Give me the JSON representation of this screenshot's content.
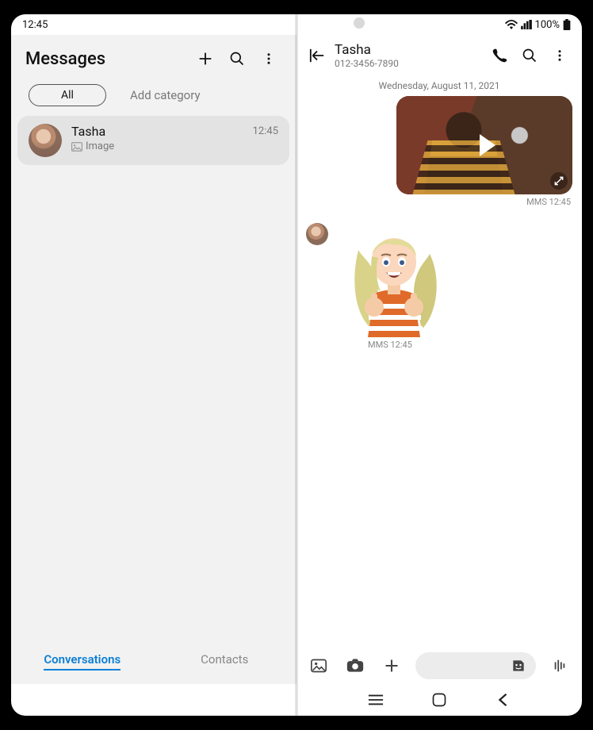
{
  "statusbar": {
    "time": "12:45",
    "battery": "100%"
  },
  "left": {
    "title": "Messages",
    "filter_all": "All",
    "add_category": "Add category",
    "conversation": {
      "name": "Tasha",
      "subtitle": "Image",
      "time": "12:45"
    },
    "tabs": {
      "conversations": "Conversations",
      "contacts": "Contacts"
    }
  },
  "right": {
    "contact_name": "Tasha",
    "contact_number": "012-3456-7890",
    "date_separator": "Wednesday, August 11, 2021",
    "outgoing_meta": "MMS  12:45",
    "incoming_meta": "MMS  12:45"
  }
}
